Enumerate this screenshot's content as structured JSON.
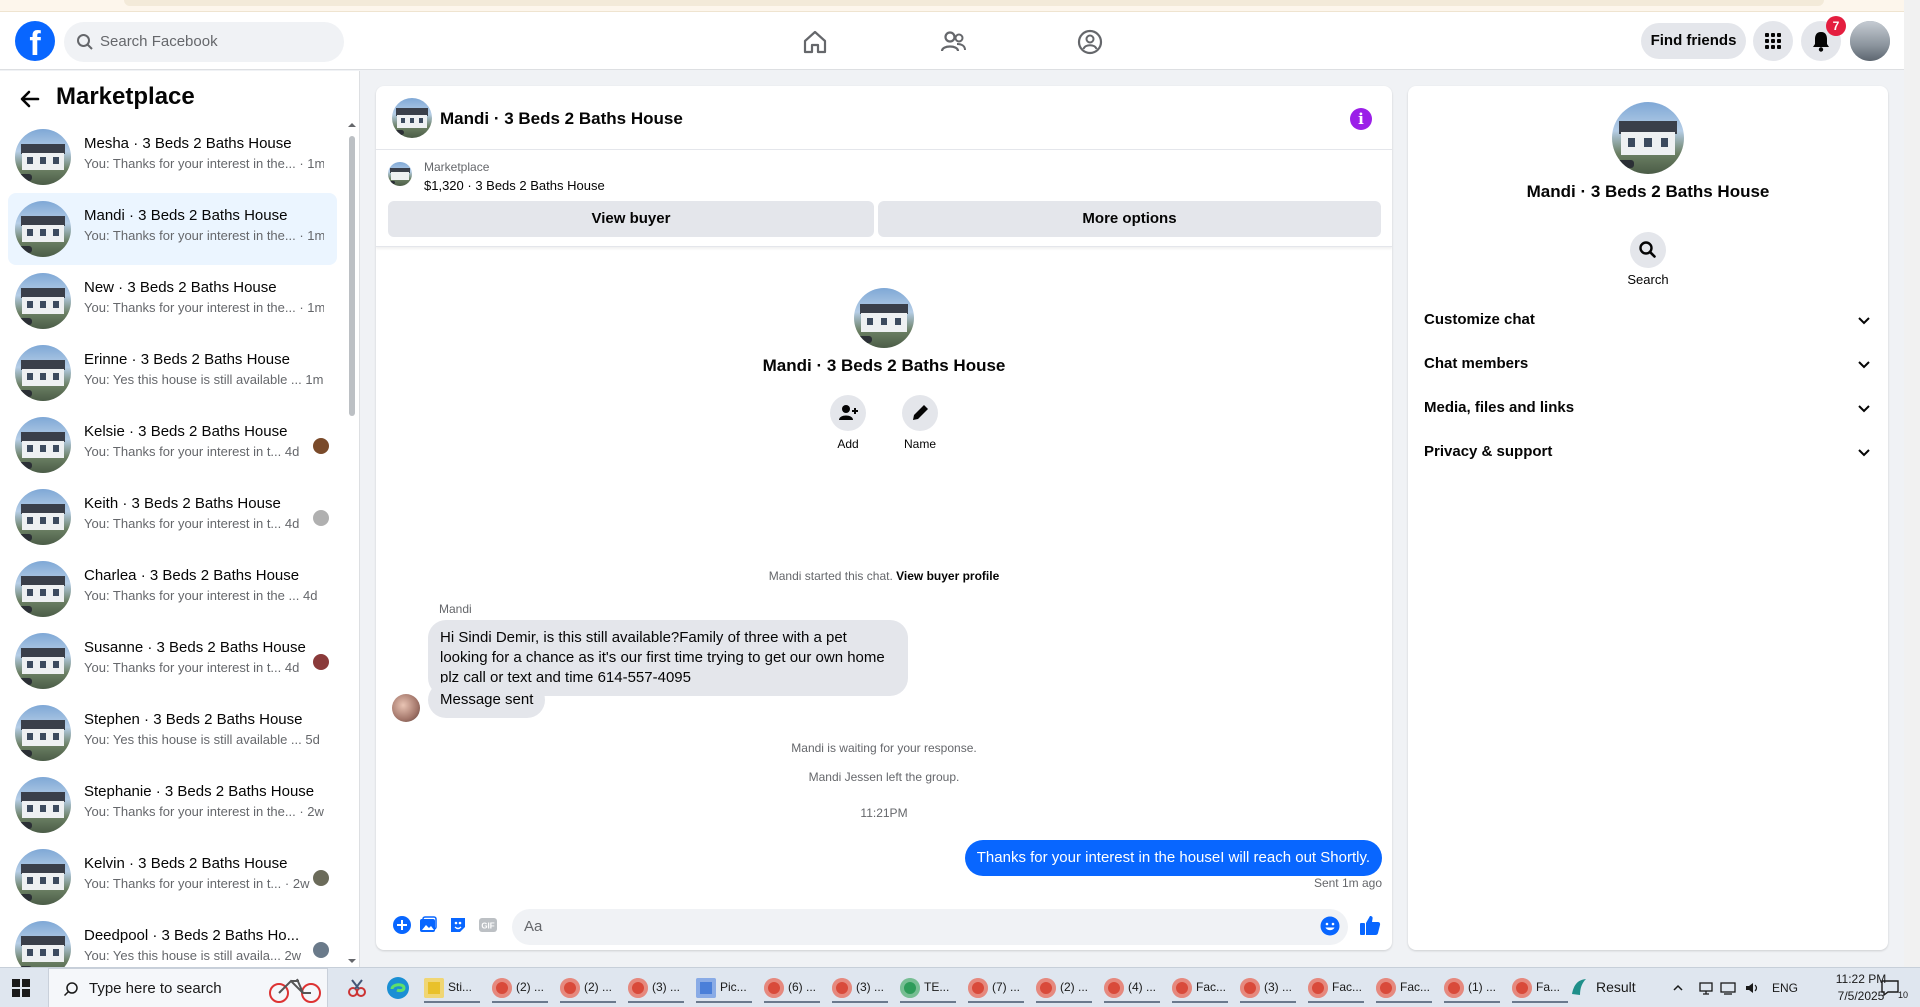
{
  "header": {
    "search_placeholder": "Search Facebook",
    "find_friends": "Find friends",
    "notification_count": "7"
  },
  "sidebar": {
    "title": "Marketplace",
    "conversations": [
      {
        "name": "Mesha · 3 Beds 2 Baths House",
        "snippet": "You: Thanks for your interest in the...",
        "time": "· 1m"
      },
      {
        "name": "Mandi · 3 Beds 2 Baths House",
        "snippet": "You: Thanks for your interest in the...",
        "time": "· 1m"
      },
      {
        "name": "New · 3 Beds 2 Baths House",
        "snippet": "You: Thanks for your interest in the...",
        "time": "· 1m"
      },
      {
        "name": "Erinne · 3 Beds 2 Baths House",
        "snippet": "You: Yes this house is still available ...",
        "time": "1m"
      },
      {
        "name": "Kelsie · 3 Beds 2 Baths House",
        "snippet": "You: Thanks for your interest in t...",
        "time": "4d"
      },
      {
        "name": "Keith · 3 Beds 2 Baths House",
        "snippet": "You: Thanks for your interest in t...",
        "time": "4d"
      },
      {
        "name": "Charlea · 3 Beds 2 Baths House",
        "snippet": "You: Thanks for your interest in the ...",
        "time": "4d"
      },
      {
        "name": "Susanne · 3 Beds 2 Baths House",
        "snippet": "You: Thanks for your interest in t...",
        "time": "4d"
      },
      {
        "name": "Stephen · 3 Beds 2 Baths House",
        "snippet": "You: Yes this house is still available ...",
        "time": "5d"
      },
      {
        "name": "Stephanie · 3 Beds 2 Baths House",
        "snippet": "You: Thanks for your interest in the...",
        "time": "· 2w"
      },
      {
        "name": "Kelvin · 3 Beds 2 Baths House",
        "snippet": "You: Thanks for your interest in t...",
        "time": "· 2w"
      },
      {
        "name": "Deedpool · 3 Beds 2 Baths Ho...",
        "snippet": "You: Yes this house is still availa...",
        "time": "2w"
      }
    ]
  },
  "chat": {
    "title": "Mandi · 3 Beds 2 Baths House",
    "listing_source": "Marketplace",
    "listing_price": "$1,320 · 3 Beds 2 Baths House",
    "view_buyer": "View buyer",
    "more_options": "More options",
    "intro_name": "Mandi · 3 Beds 2 Baths House",
    "add_label": "Add",
    "name_label": "Name",
    "started_text": "Mandi started this chat.",
    "view_buyer_profile": "View buyer profile",
    "sender": "Mandi",
    "incoming_message": "Hi Sindi Demir, is this still available?Family of three with a pet looking for a chance as it's our first time trying to get our own home plz call or text and time 614-557-4095",
    "message_sent": "Message sent",
    "waiting_text": "Mandi is waiting for your response.",
    "left_text": "Mandi Jessen left the group.",
    "timestamp": "11:21PM",
    "outgoing_message": "Thanks for your interest in the houseI will reach out Shortly.",
    "sent_status": "Sent 1m ago",
    "composer_placeholder": "Aa"
  },
  "right_panel": {
    "name": "Mandi · 3 Beds 2 Baths House",
    "search_label": "Search",
    "sections": [
      "Customize chat",
      "Chat members",
      "Media, files and links",
      "Privacy & support"
    ]
  },
  "taskbar": {
    "search_placeholder": "Type here to search",
    "apps": [
      "Sti...",
      "(2) ...",
      "(2) ...",
      "(3) ...",
      "Pic...",
      "(6) ...",
      "(3) ...",
      "TE...",
      "(7) ...",
      "(2) ...",
      "(4) ...",
      "Fac...",
      "(3) ...",
      "Fac...",
      "Fac...",
      "(1) ...",
      "Fa..."
    ],
    "weather": "Result",
    "language": "ENG",
    "time": "11:22 PM",
    "date": "7/5/2025",
    "notif_count": "10"
  },
  "colors": {
    "brand": "#0866ff",
    "active_item": "#ebf5ff",
    "info_icon": "#9b1fe8",
    "badge": "#e41e3f"
  }
}
